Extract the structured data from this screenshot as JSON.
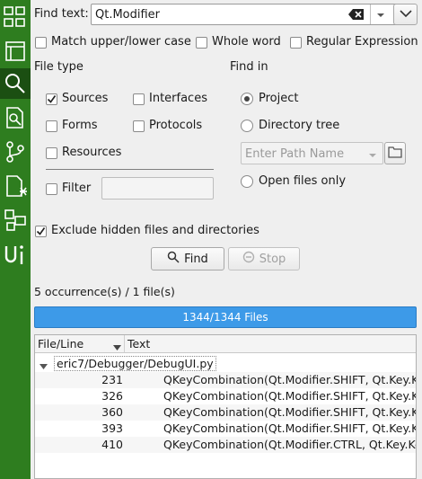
{
  "sidebar": {
    "icons": [
      "multiproject-icon",
      "project-viewer-icon",
      "find-icon",
      "find-file-icon",
      "vcs-icon",
      "new-file-icon",
      "template-icon",
      "ui-icon"
    ]
  },
  "find": {
    "label": "Find text:",
    "value": "Qt.Modifier"
  },
  "options": {
    "match_case": "Match upper/lower case",
    "whole_word": "Whole word",
    "regex": "Regular Expression"
  },
  "file_type": {
    "title": "File type",
    "sources": "Sources",
    "interfaces": "Interfaces",
    "forms": "Forms",
    "protocols": "Protocols",
    "resources": "Resources",
    "filter": "Filter"
  },
  "find_in": {
    "title": "Find in",
    "project": "Project",
    "directory_tree": "Directory tree",
    "path_placeholder": "Enter Path Name",
    "open_files": "Open files only"
  },
  "exclude_hidden": "Exclude hidden files and directories",
  "buttons": {
    "find": "Find",
    "stop": "Stop"
  },
  "summary": "5 occurrence(s) / 1 file(s)",
  "progress": {
    "text": "1344/1344 Files",
    "fraction": 1.0
  },
  "results": {
    "columns": [
      "File/Line",
      "Text"
    ],
    "file": "eric7/Debugger/DebugUI.py",
    "rows": [
      {
        "line": "231",
        "text": "QKeyCombination(Qt.Modifier.SHIFT, Qt.Key.Ke"
      },
      {
        "line": "326",
        "text": "QKeyCombination(Qt.Modifier.SHIFT, Qt.Key.Ke"
      },
      {
        "line": "360",
        "text": "QKeyCombination(Qt.Modifier.SHIFT, Qt.Key.Ke"
      },
      {
        "line": "393",
        "text": "QKeyCombination(Qt.Modifier.SHIFT, Qt.Key.Ke"
      },
      {
        "line": "410",
        "text": "QKeyCombination(Qt.Modifier.CTRL, Qt.Key.Ke"
      }
    ]
  },
  "colors": {
    "sidebar": "#2e7d1f",
    "sidebar_active": "#1b4f12",
    "progress": "#3d9ae8"
  }
}
